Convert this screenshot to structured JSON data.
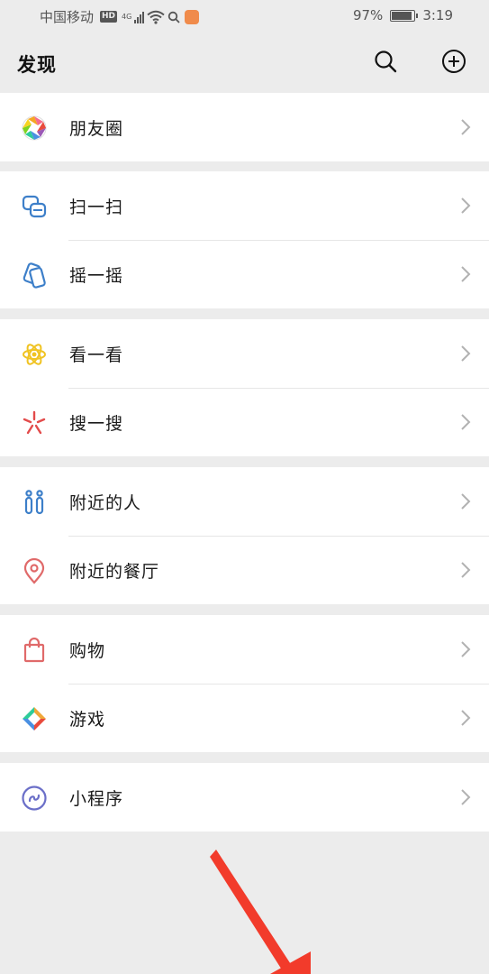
{
  "status_bar": {
    "carrier": "中国移动",
    "hd": "HD",
    "network": "4G",
    "battery_text": "97%",
    "battery_level": 0.97,
    "time": "3:19"
  },
  "header": {
    "title": "发现"
  },
  "menu": {
    "moments": "朋友圈",
    "scan": "扫一扫",
    "shake": "摇一摇",
    "top_stories": "看一看",
    "search": "搜一搜",
    "people_nearby": "附近的人",
    "restaurants_nearby": "附近的餐厅",
    "shopping": "购物",
    "games": "游戏",
    "mini_programs": "小程序"
  },
  "colors": {
    "background": "#ececec",
    "list_background": "#ffffff",
    "scan_blue": "#3d7fc9",
    "top_stories_yellow": "#f0c322",
    "search_red": "#e34b4b",
    "nearby_blue": "#3d7fc9",
    "restaurant_red": "#e06a6a",
    "shopping_red": "#e06a6a",
    "mini_program_purple": "#6b6fc8",
    "annotation_arrow": "#f23b2b"
  },
  "icons": {
    "moments": "moments-aperture-icon",
    "scan": "scan-icon",
    "shake": "shake-icon",
    "top_stories": "top-stories-icon",
    "search": "search-sparkle-icon",
    "people_nearby": "people-nearby-icon",
    "restaurants_nearby": "location-pin-icon",
    "shopping": "shopping-bag-icon",
    "games": "games-diamond-icon",
    "mini_programs": "mini-programs-icon"
  }
}
